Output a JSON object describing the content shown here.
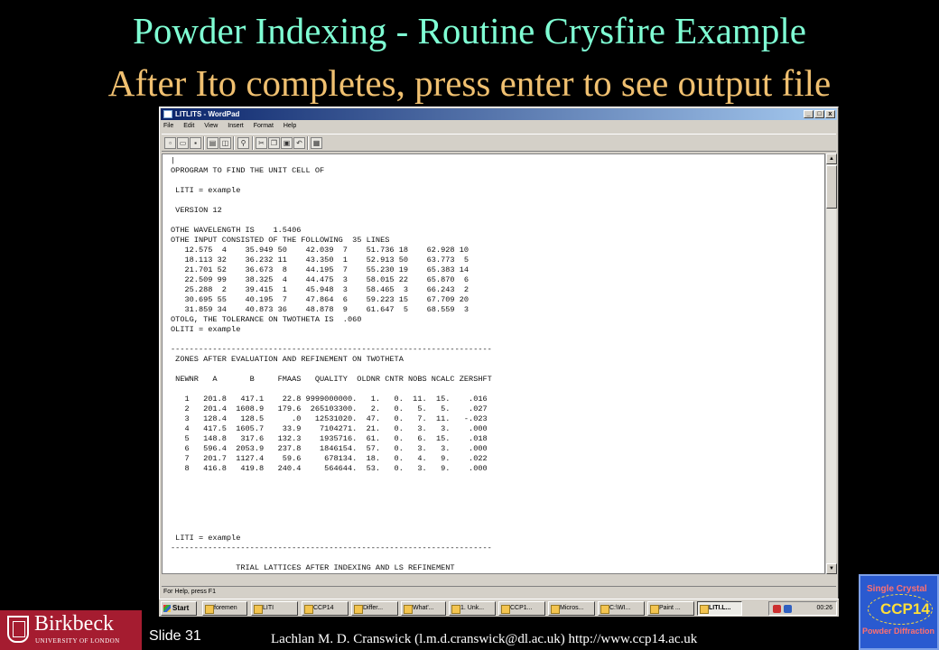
{
  "slide": {
    "title": "Powder Indexing - Routine Crysfire Example",
    "subtitle": "After Ito completes, press enter to see output file",
    "slide_number": "Slide 31",
    "credit": "Lachlan M. D. Cranswick (l.m.d.cranswick@dl.ac.uk) http://www.ccp14.ac.uk"
  },
  "window": {
    "title": "LITLITS - WordPad",
    "controls": [
      "_",
      "□",
      "x"
    ],
    "menu": [
      "File",
      "Edit",
      "View",
      "Insert",
      "Format",
      "Help"
    ],
    "status": "For Help, press F1",
    "document_text": "|\nOPROGRAM TO FIND THE UNIT CELL OF\n\n LITI = example\n\n VERSION 12\n\nOTHE WAVELENGTH IS    1.5406\nOTHE INPUT CONSISTED OF THE FOLLOWING  35 LINES\n   12.575  4    35.949 50    42.039  7    51.736 18    62.928 10\n   18.113 32    36.232 11    43.350  1    52.913 50    63.773  5\n   21.701 52    36.673  8    44.195  7    55.230 19    65.383 14\n   22.509 99    38.325  4    44.475  3    58.015 22    65.870  6\n   25.288  2    39.415  1    45.948  3    58.465  3    66.243  2\n   30.695 55    40.195  7    47.864  6    59.223 15    67.709 20\n   31.859 34    40.873 36    48.878  9    61.647  5    68.559  3\nOTOLG, THE TOLERANCE ON TWOTHETA IS  .060\nOLITI = example\n\n---------------------------------------------------------------------\n ZONES AFTER EVALUATION AND REFINEMENT ON TWOTHETA\n\n NEWNR   A       B     FMAAS   QUALITY  OLDNR CNTR NOBS NCALC ZERSHFT\n\n   1   201.8   417.1    22.8 9999000000.   1.   0.  11.  15.    .016\n   2   201.4  1608.9   179.6  265103300.   2.   0.   5.   5.    .027\n   3   128.4   128.5      .0   12531020.  47.   0.   7.  11.   -.023\n   4   417.5  1605.7    33.9    7104271.  21.   0.   3.   3.    .000\n   5   148.8   317.6   132.3    1935716.  61.   0.   6.  15.    .018\n   6   596.4  2053.9   237.8    1846154.  57.   0.   3.   3.    .000\n   7   201.7  1127.4    59.6     678134.  18.   0.   4.   9.    .022\n   8   416.8   419.8   240.4     564644.  53.   0.   3.   9.    .000\n\n\n\n\n\n\n LITI = example\n---------------------------------------------------------------------\n\n              TRIAL LATTICES AFTER INDEXING AND LS REFINEMENT"
  },
  "taskbar": {
    "start": "Start",
    "tasks": [
      "foremen",
      "LITI",
      "CCP14",
      "Differ...",
      "What'...",
      "1. Unk...",
      "CCP1...",
      "Micros...",
      "C:\\WI...",
      "Paint ...",
      "LITI.L..."
    ],
    "clock": "00:26"
  },
  "logos": {
    "birkbeck_name": "Birkbeck",
    "birkbeck_sub": "UNIVERSITY OF LONDON",
    "ccp14_line1": "Single Crystal",
    "ccp14_line2": "CCP14",
    "ccp14_line3": "Powder Diffraction"
  }
}
